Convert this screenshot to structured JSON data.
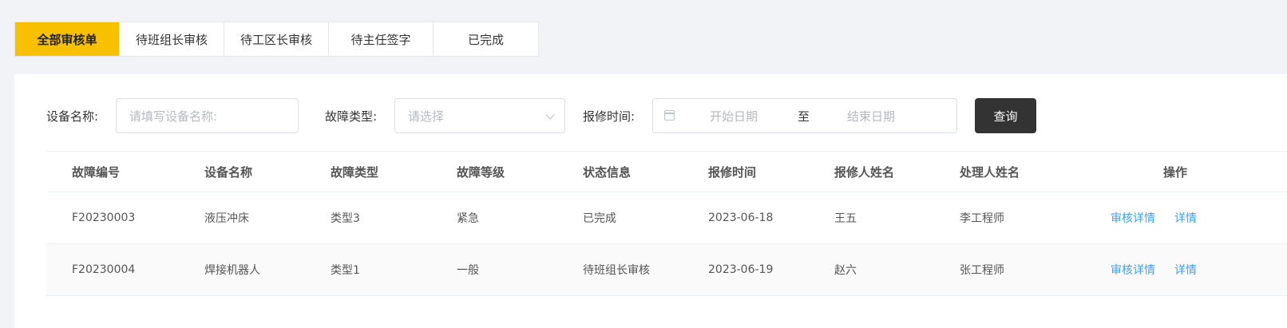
{
  "tabs": [
    {
      "label": "全部审核单",
      "active": true
    },
    {
      "label": "待班组长审核",
      "active": false
    },
    {
      "label": "待工区长审核",
      "active": false
    },
    {
      "label": "待主任签字",
      "active": false
    },
    {
      "label": "已完成",
      "active": false
    }
  ],
  "filters": {
    "device_name_label": "设备名称:",
    "device_name_placeholder": "请填写设备名称:",
    "fault_type_label": "故障类型:",
    "fault_type_placeholder": "请选择",
    "report_time_label": "报修时间:",
    "date_start_placeholder": "开始日期",
    "date_separator": "至",
    "date_end_placeholder": "结束日期",
    "query_button": "查询"
  },
  "table": {
    "columns": [
      "故障编号",
      "设备名称",
      "故障类型",
      "故障等级",
      "状态信息",
      "报修时间",
      "报修人姓名",
      "处理人姓名",
      "操作"
    ],
    "rows": [
      {
        "id": "F20230003",
        "device": "液压冲床",
        "type": "类型3",
        "level": "紧急",
        "status": "已完成",
        "time": "2023-06-18",
        "reporter": "王五",
        "handler": "李工程师",
        "action_review": "审核详情",
        "action_detail": "详情"
      },
      {
        "id": "F20230004",
        "device": "焊接机器人",
        "type": "类型1",
        "level": "一般",
        "status": "待班组长审核",
        "time": "2023-06-19",
        "reporter": "赵六",
        "handler": "张工程师",
        "action_review": "审核详情",
        "action_detail": "详情"
      }
    ]
  },
  "colors": {
    "accent": "#f7c100",
    "link": "#409eff",
    "button_dark": "#333333",
    "page_bg": "#f2f3f6"
  }
}
